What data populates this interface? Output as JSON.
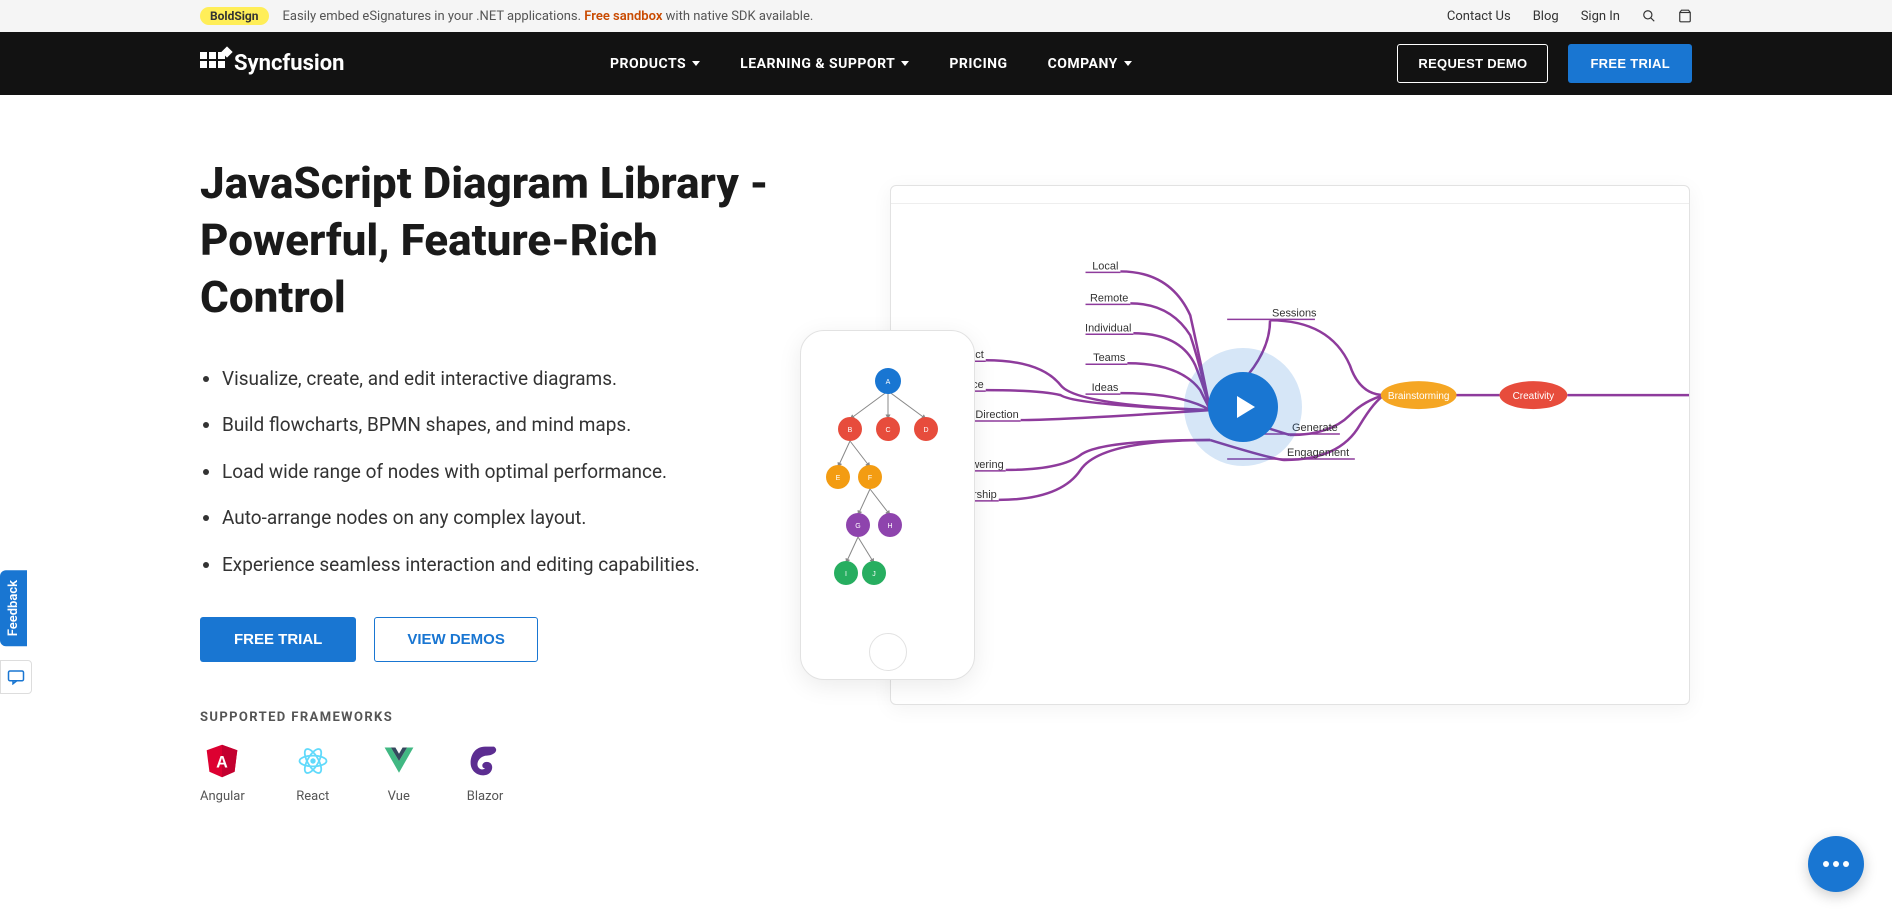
{
  "topbar": {
    "badge": "BoldSign",
    "text_a": "Easily embed eSignatures in your .NET applications. ",
    "text_highlight": "Free sandbox",
    "text_b": " with native SDK available.",
    "contact": "Contact Us",
    "blog": "Blog",
    "signin": "Sign In"
  },
  "nav": {
    "brand": "Syncfusion",
    "items": [
      "PRODUCTS",
      "LEARNING & SUPPORT",
      "PRICING",
      "COMPANY"
    ],
    "request_demo": "REQUEST DEMO",
    "free_trial": "FREE TRIAL"
  },
  "hero": {
    "title": "JavaScript Diagram Library - Powerful, Feature-Rich Control",
    "bullets": [
      "Visualize, create, and edit interactive diagrams.",
      "Build flowcharts, BPMN shapes, and mind maps.",
      "Load wide range of nodes with optimal performance.",
      "Auto-arrange nodes on any complex layout.",
      "Experience seamless interaction and editing capabilities."
    ],
    "trial_btn": "FREE TRIAL",
    "demos_btn": "VIEW DEMOS",
    "frameworks_label": "SUPPORTED FRAMEWORKS",
    "frameworks": [
      "Angular",
      "React",
      "Vue",
      "Blazor"
    ]
  },
  "mindmap": {
    "col1": [
      "Product",
      "Service",
      "Business Direction",
      "Empowering",
      "Ownership"
    ],
    "col2": [
      "Local",
      "Remote",
      "Individual",
      "Teams",
      "Ideas"
    ],
    "col3": [
      "Sessions",
      "Generate",
      "Engagement"
    ],
    "brainstorming": "Brainstorming",
    "creativity": "Creativity"
  },
  "tree_nodes": [
    "A",
    "B",
    "C",
    "D",
    "E",
    "F",
    "G",
    "H",
    "I",
    "J"
  ],
  "feedback_label": "Feedback"
}
